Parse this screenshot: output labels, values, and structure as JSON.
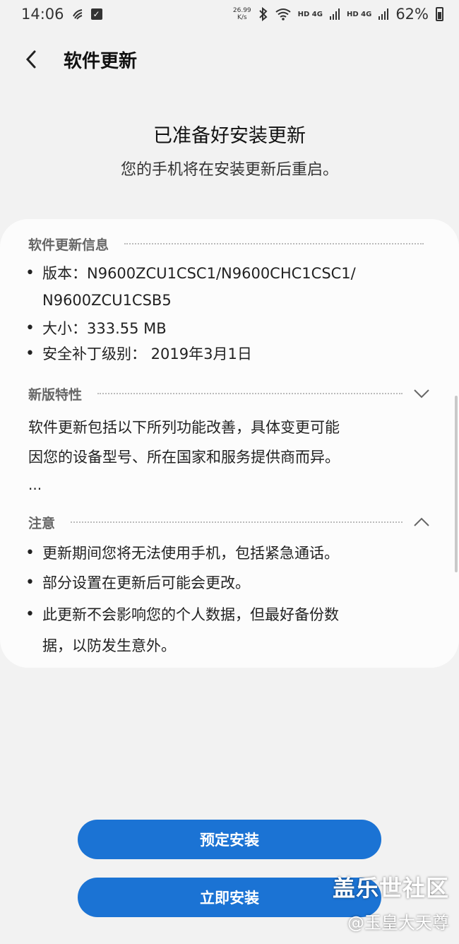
{
  "status_bar": {
    "time": "14:06",
    "net_speed_value": "26.99",
    "net_speed_unit": "K/s",
    "sim1": "HD 4G",
    "sim2": "HD 4G",
    "battery": "62%"
  },
  "header": {
    "title": "软件更新"
  },
  "hero": {
    "title": "已准备好安装更新",
    "subtitle": "您的手机将在安装更新后重启。"
  },
  "info_section": {
    "label": "软件更新信息",
    "version_line1": "版本：N9600ZCU1CSC1/N9600CHC1CSC1/",
    "version_line2": "N9600ZCU1CSB5",
    "size": "大小：333.55 MB",
    "security_patch": "安全补丁级别： 2019年3月1日"
  },
  "features_section": {
    "label": "新版特性",
    "line1": "软件更新包括以下所列功能改善，具体变更可能",
    "line2": "因您的设备型号、所在国家和服务提供商而异。",
    "ellipsis": "..."
  },
  "notes_section": {
    "label": "注意",
    "note1": "更新期间您将无法使用手机，包括紧急通话。",
    "note2": "部分设置在更新后可能会更改。",
    "note3_line1": "此更新不会影响您的个人数据，但最好备份数",
    "note3_line2": "据，以防发生意外。"
  },
  "buttons": {
    "schedule": "预定安装",
    "install_now": "立即安装"
  },
  "watermark": {
    "line1": "盖乐世社区",
    "line2": "@玉皇大天尊"
  },
  "colors": {
    "accent": "#1b73d4",
    "background": "#f2f2f2",
    "card": "#fcfcfc"
  },
  "icons": {
    "back": "chevron-left-icon",
    "collapse_features": "chevron-down-icon",
    "collapse_notes": "chevron-up-icon"
  }
}
